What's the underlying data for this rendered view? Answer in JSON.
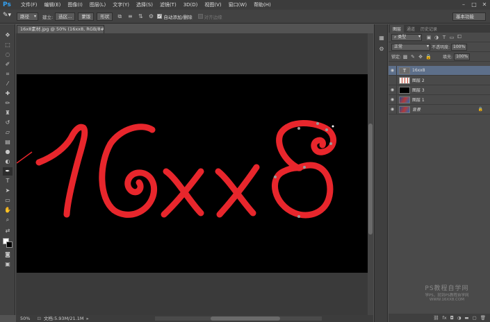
{
  "app": {
    "logo": "Ps"
  },
  "menu": [
    "文件(F)",
    "编辑(E)",
    "图像(I)",
    "图层(L)",
    "文字(Y)",
    "选择(S)",
    "滤镜(T)",
    "3D(D)",
    "视图(V)",
    "窗口(W)",
    "帮助(H)"
  ],
  "window_controls": [
    "–",
    "□",
    "✕"
  ],
  "options": {
    "mode": "路径",
    "make_label": "建立:",
    "selection_btn": "选区...",
    "mask_btn": "蒙版",
    "shape_btn": "形状",
    "auto_add_label": "自动添加/删除",
    "align_edges_label": "对齐边缘",
    "workspace": "基本功能"
  },
  "document": {
    "tab_title": "16x8素材.jpg @ 50% (16xx8, RGB/8#) *",
    "text": "16xx8",
    "text_color": "#e8262c"
  },
  "status": {
    "zoom": "50%",
    "doc_info": "文档:5.93M/21.1M"
  },
  "layers_panel": {
    "tabs": [
      "图层",
      "通道",
      "历史记录"
    ],
    "filter": "类型",
    "blend_mode": "正常",
    "opacity_label": "不透明度:",
    "opacity": "100%",
    "lock_label": "锁定:",
    "fill_label": "填充:",
    "fill": "100%",
    "layers": [
      {
        "name": "16xx8",
        "visible": true,
        "selected": true,
        "kind": "text"
      },
      {
        "name": "图层 2",
        "visible": false,
        "selected": false,
        "kind": "pattern"
      },
      {
        "name": "图层 3",
        "visible": true,
        "selected": false,
        "kind": "black"
      },
      {
        "name": "图层 1",
        "visible": true,
        "selected": false,
        "kind": "image"
      },
      {
        "name": "背景",
        "visible": true,
        "selected": false,
        "kind": "image",
        "locked": true
      }
    ],
    "footer_icons": [
      "link-icon",
      "fx-icon",
      "mask-icon",
      "adjustment-icon",
      "folder-icon",
      "new-layer-icon",
      "trash-icon"
    ]
  },
  "watermark": {
    "line1": "PS教程自学网",
    "line2": "学PS，就到PS教程自学网",
    "line3": "WWW.16XX8.COM"
  }
}
